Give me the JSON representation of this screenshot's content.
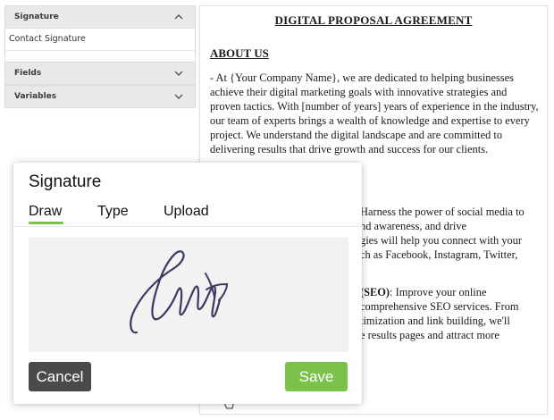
{
  "sidebar": {
    "signature_section": {
      "title": "Signature",
      "item": "Contact Signature",
      "chevron": "chevron-up-icon"
    },
    "fields_section": {
      "title": "Fields",
      "chevron": "chevron-down-icon"
    },
    "variables_section": {
      "title": "Variables",
      "chevron": "chevron-down-icon"
    }
  },
  "document": {
    "title": "DIGITAL PROPOSAL AGREEMENT",
    "heading": "ABOUT US",
    "paragraph1": "- At {Your Company Name}, we are dedicated to helping businesses achieve their digital marketing goals with innovative strategies and proven tactics. With [number of years] years of experience in the industry, our team of experts brings a wealth of knowledge and expertise to every project. We understand the digital landscape and are committed to delivering results that drive growth and success for our clients.",
    "paragraph2_lines": [
      "Harness the power of social media to",
      "nd awareness, and drive",
      "gies will help you connect with your",
      "ch as Facebook, Instagram, Twitter,"
    ],
    "paragraph3_bold": "(SEO)",
    "paragraph3_lines": [
      ": Improve your online",
      "comprehensive SEO services. From",
      "timization and link building, we'll",
      "e results pages and attract more"
    ]
  },
  "modal": {
    "title": "Signature",
    "tabs": [
      {
        "label": "Draw",
        "active": true
      },
      {
        "label": "Type",
        "active": false
      },
      {
        "label": "Upload",
        "active": false
      }
    ],
    "cancel_label": "Cancel",
    "save_label": "Save"
  },
  "colors": {
    "accent_green": "#7ac24a",
    "cancel_gray": "#4a4a4a",
    "signature_ink": "#3a3b62",
    "canvas_bg": "#f2f2f2"
  }
}
